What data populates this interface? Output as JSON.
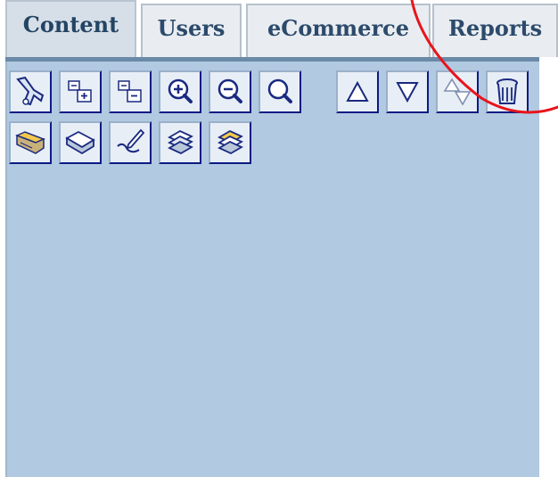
{
  "tabs": [
    {
      "id": "content",
      "label": "Content",
      "active": true
    },
    {
      "id": "users",
      "label": "Users",
      "active": false
    },
    {
      "id": "ecommerce",
      "label": "eCommerce",
      "active": false
    },
    {
      "id": "reports",
      "label": "Reports",
      "active": false
    }
  ],
  "toolbar": {
    "row1": [
      "cut-icon",
      "expand-all-icon",
      "collapse-all-icon",
      "zoom-in-icon",
      "zoom-out-icon",
      "search-icon",
      "move-up-icon",
      "move-down-icon",
      "sort-icon",
      "delete-icon"
    ],
    "row2": [
      "open-folder-icon",
      "book-icon",
      "edit-icon",
      "copy-icon",
      "paste-icon"
    ]
  },
  "colors": {
    "panel_background": "#b1c9e1",
    "tab_text": "#2c4a6b",
    "button_border": "#0c1b83",
    "annotation": "#e8141c"
  }
}
